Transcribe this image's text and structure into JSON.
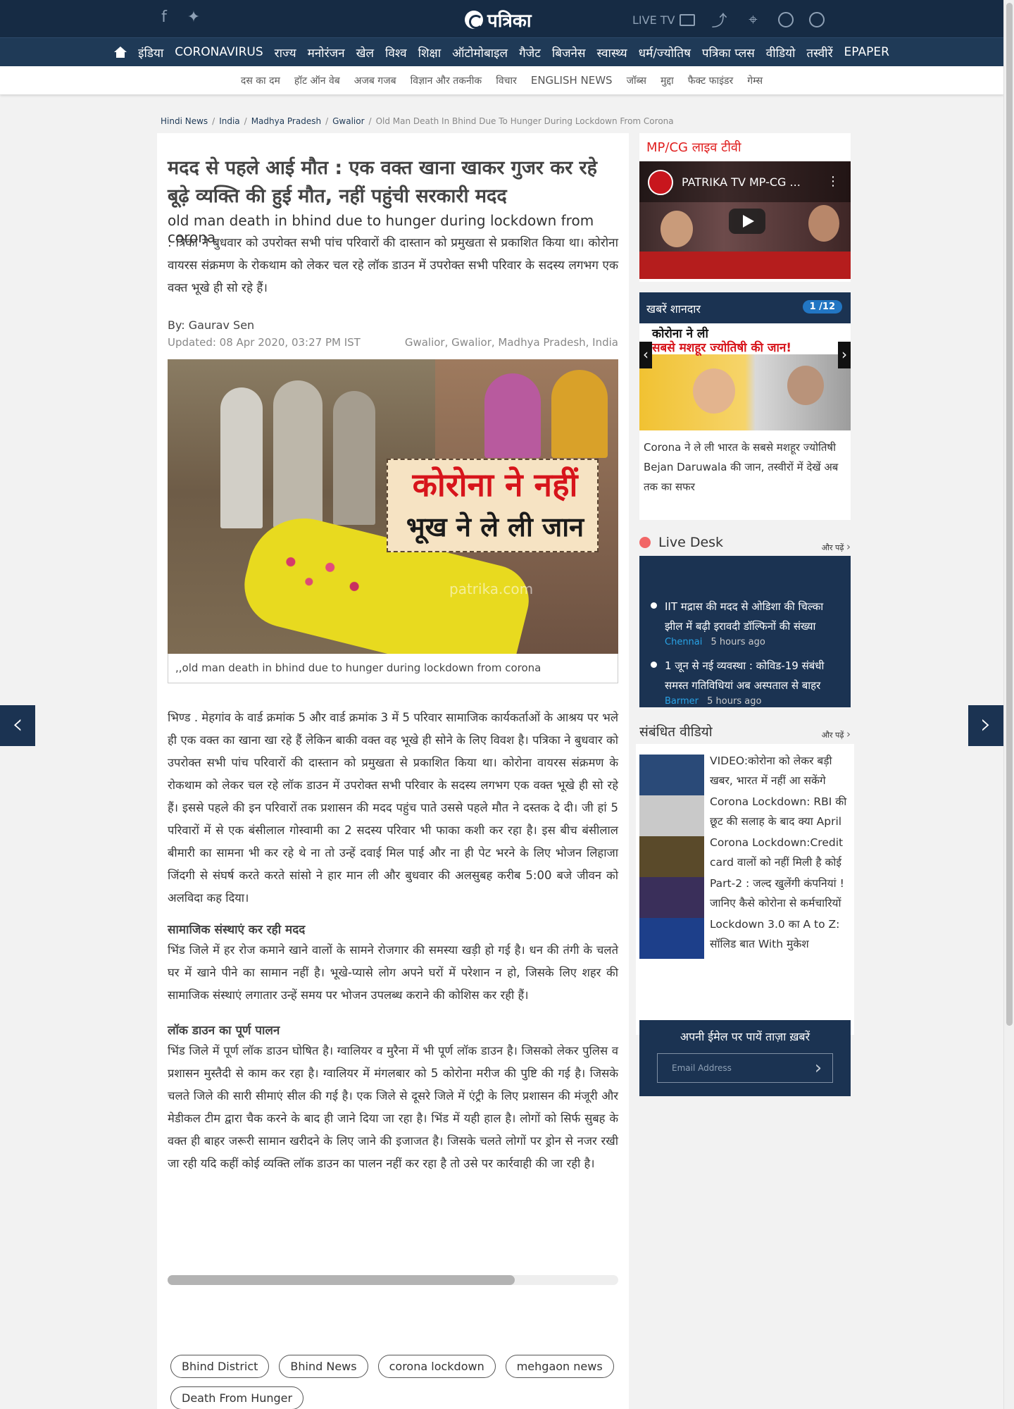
{
  "header": {
    "logo_text": "पत्रिका",
    "live_tv_label": "LIVE TV"
  },
  "main_nav": [
    "इंडिया",
    "CORONAVIRUS",
    "राज्य",
    "मनोरंजन",
    "खेल",
    "विश्व",
    "शिक्षा",
    "ऑटोमोबाइल",
    "गैजेट",
    "बिजनेस",
    "स्वास्थ्य",
    "धर्म/ज्योतिष",
    "पत्रिका प्लस",
    "वीडियो",
    "तस्वीरें",
    "EPAPER"
  ],
  "sub_nav": [
    "दस का दम",
    "हॉट ऑन वेब",
    "अजब गजब",
    "विज्ञान और तकनीक",
    "विचार",
    "ENGLISH NEWS",
    "जॉब्स",
    "मुद्दा",
    "फैक्ट फाइंडर",
    "गेम्स"
  ],
  "breadcrumb": [
    "Hindi News",
    "India",
    "Madhya Pradesh",
    "Gwalior",
    "Old Man Death In Bhind Due To Hunger During Lockdown From Corona"
  ],
  "article": {
    "headline": "मदद से पहले आई मौत : एक वक्त खाना खाकर गुजर कर रहे बूढ़े व्यक्ति की हुई मौत, नहीं पहुंची सरकारी मदद",
    "subhead_en": "old man death in bhind due to hunger during lockdown from corona",
    "summary": ": त्रिका ने बुधवार को उपरोक्त सभी पांच परिवारों की दास्तान को प्रमुखता से प्रकाशित किया था। कोरोना वायरस संक्रमण के रोकथाम को लेकर चल रहे लॉक डाउन में उपरोक्त सभी परिवार के सदस्य लगभग एक वक्त भूखे ही सो रहे हैं।",
    "byline": "By: Gaurav Sen",
    "updated": "Updated: 08 Apr 2020, 03:27 PM IST",
    "location": "Gwalior, Gwalior, Madhya Pradesh, India",
    "image_text_line1": "कोरोना ने नहीं",
    "image_text_line2": "भूख ने ले ली जान",
    "image_watermark": "patrika.com",
    "image_caption": ",,old man death in bhind due to hunger during lockdown from corona",
    "para1": "भिण्ड . मेहगांव के वार्ड क्रमांक 5 और वार्ड क्रमांक 3 में 5 परिवार सामाजिक कार्यकर्ताओं के आश्रय पर भले ही एक वक्त का खाना खा रहे हैं लेकिन बाकी वक्त वह भूखे ही सोने के लिए विवश है। पत्रिका ने बुधवार को उपरोक्त सभी पांच परिवारों की दास्तान को प्रमुखता से प्रकाशित किया था। कोरोना वायरस संक्रमण के रोकथाम को लेकर चल रहे लॉक डाउन में उपरोक्त सभी परिवार के सदस्य लगभग एक वक्त भूखे ही सो रहे हैं। इससे पहले की इन परिवारों तक प्रशासन की मदद पहुंच पाते उससे पहले मौत ने दस्तक दे दी। जी हां 5 परिवारों में से एक बंसीलाल गोस्वामी का 2 सदस्य परिवार भी फाका कशी कर रहा है। इस बीच बंसीलाल बीमारी का सामना भी कर रहे थे ना तो उन्हें दवाई मिल पाई और ना ही पेट भरने के लिए भोजन लिहाजा जिंदगी से संघर्ष करते करते सांसो ने हार मान ली और बुधवार की अलसुबह करीब 5:00 बजे जीवन को अलविदा कह दिया।",
    "section2_head": "सामाजिक संस्थाएं कर रही मदद",
    "para2": "भिंड जिले में हर रोज कमाने खाने वालों के सामने रोजगार की समस्या खड़ी हो गई है। धन की तंगी के चलते घर में खाने पीने का सामान नहीं है। भूखे-प्यासे लोग अपने घरों में परेशान न हो, जिसके लिए शहर की सामाजिक संस्थाएं लगातार उन्हें समय पर भोजन उपलब्ध कराने की कोशिस कर रही हैं।",
    "section3_head": "लॉक डाउन का पूर्ण पालन",
    "para3": "भिंड जिले में पूर्ण लॉक डाउन घोषित है। ग्वालियर व मुरैना में भी पूर्ण लॉक डाउन है। जिसको लेकर पुलिस व प्रशासन मुस्तैदी से काम कर रहा है। ग्वालियर में मंगलबार को 5 कोरोना मरीज की पुष्टि की गई है। जिसके चलते जिले की सारी सीमाएं सील की गई है। एक जिले से दूसरे जिले में एंट्री के लिए प्रशासन की मंजूरी और मेडीकल टीम द्वारा चैक करने के बाद ही जाने दिया जा रहा है। भिंड में यही हाल है। लोगों को सिर्फ सुबह के वक्त ही बाहर जरूरी सामान खरीदने के लिए जाने की इजाजत है। जिसके चलते लोगों पर ड्रोन से नजर रखी जा रही यदि कहीं कोई व्यक्ति लॉक डाउन का पालन नहीं कर रहा है तो उसे पर कार्रवाही की जा रही है।",
    "scroll_progress": 0.77,
    "tags": [
      "Bhind District",
      "Bhind News",
      "corona lockdown",
      "mehgaon news",
      "Death From Hunger"
    ]
  },
  "sidebar": {
    "live_tv_title": "MP/CG लाइव टीवी",
    "video_title": "PATRIKA TV MP-CG ...",
    "khabar_title": "खबरें शानदार",
    "khabar_page": "1 /12",
    "khabar_banner_line1": "कोरोना ने ली",
    "khabar_banner_line2": "सबसे मशहूर ज्योतिषी की जान!",
    "khabar_caption": "Corona ने ले ली भारत के सबसे मशहूर ज्योतिषी Bejan Daruwala की जान, तस्वीरों में देखें अब तक का सफर",
    "live_desk_title": "Live Desk",
    "more_label": "और पढ़ें",
    "live_desk_items": [
      {
        "text": "IIT मद्रास की मदद से ओडिशा की चिल्का झील में बढ़ी इरावदी डॉल्फिनों की संख्या",
        "city": "Chennai",
        "ago": "5 hours ago"
      },
      {
        "text": "1 जून से नई व्यवस्था : कोविड-19 संबंधी समस्त गतिविधियां अब अस्पताल से बाहर",
        "city": "Barmer",
        "ago": "5 hours ago"
      }
    ],
    "related_videos_title": "संबंधित वीडियो",
    "related_videos": [
      {
        "title": "VIDEO:कोरोना को लेकर बड़ी खबर, भारत में नहीं आ सकेंगे",
        "thumb_color": "#2a4a78"
      },
      {
        "title": "Corona Lockdown: RBI की छूट की सलाह के बाद क्या April",
        "thumb_color": "#c9c9c9"
      },
      {
        "title": "Corona Lockdown:Credit card वालों को नहीं मिली है कोई",
        "thumb_color": "#5a4a2a"
      },
      {
        "title": "Part-2 : जल्द खुलेंगी कंपनियां ! जानिए कैसे कोरोना से कर्मचारियों",
        "thumb_color": "#3a2f5a"
      },
      {
        "title": "Lockdown 3.0 का A to Z: सॉलिड बात With मुकेश",
        "thumb_color": "#1d3f8a"
      }
    ],
    "email_title": "अपनी ईमेल पर पायें ताज़ा ख़बरें",
    "email_placeholder": "Email Address"
  },
  "colors": {
    "header_bg": "#162b44",
    "nav_bg": "#1f3a57",
    "sidebar_dark": "#1b3352",
    "accent_red": "#e02020",
    "link_blue": "#29a3e6"
  }
}
